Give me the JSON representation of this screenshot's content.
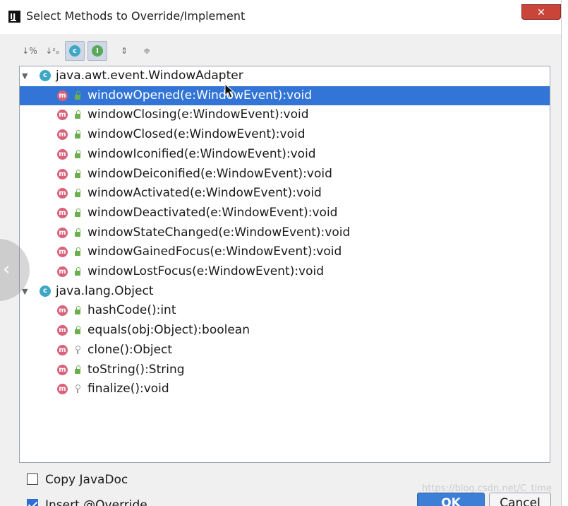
{
  "window": {
    "title": "Select Methods to Override/Implement",
    "close_label": "✕"
  },
  "toolbar": {
    "sort_visibility_glyph": "↓%",
    "sort_alpha_glyph": "↓ᶻₐ",
    "class_badge": "c",
    "interface_badge": "I",
    "expand_glyph": "⇕",
    "collapse_glyph": "≑"
  },
  "tree": {
    "groups": [
      {
        "class_name": "java.awt.event.WindowAdapter",
        "methods": [
          {
            "label": "windowOpened(e:WindowEvent):void",
            "visibility": "public",
            "selected": true
          },
          {
            "label": "windowClosing(e:WindowEvent):void",
            "visibility": "public"
          },
          {
            "label": "windowClosed(e:WindowEvent):void",
            "visibility": "public"
          },
          {
            "label": "windowIconified(e:WindowEvent):void",
            "visibility": "public"
          },
          {
            "label": "windowDeiconified(e:WindowEvent):void",
            "visibility": "public"
          },
          {
            "label": "windowActivated(e:WindowEvent):void",
            "visibility": "public"
          },
          {
            "label": "windowDeactivated(e:WindowEvent):void",
            "visibility": "public"
          },
          {
            "label": "windowStateChanged(e:WindowEvent):void",
            "visibility": "public"
          },
          {
            "label": "windowGainedFocus(e:WindowEvent):void",
            "visibility": "public"
          },
          {
            "label": "windowLostFocus(e:WindowEvent):void",
            "visibility": "public"
          }
        ]
      },
      {
        "class_name": "java.lang.Object",
        "methods": [
          {
            "label": "hashCode():int",
            "visibility": "public"
          },
          {
            "label": "equals(obj:Object):boolean",
            "visibility": "public"
          },
          {
            "label": "clone():Object",
            "visibility": "protected"
          },
          {
            "label": "toString():String",
            "visibility": "public"
          },
          {
            "label": "finalize():void",
            "visibility": "protected"
          }
        ]
      }
    ],
    "method_badge": "m",
    "class_badge": "c"
  },
  "options": {
    "copy_javadoc": {
      "label": "Copy JavaDoc",
      "checked": false
    },
    "insert_override": {
      "label": "Insert @Override",
      "checked": true
    }
  },
  "buttons": {
    "ok": "OK",
    "cancel": "Cancel"
  },
  "watermark": "https://blog.csdn.net/C_time",
  "colors": {
    "selection": "#3375d6",
    "method_icon": "#d9627a",
    "class_icon": "#3fa7c6",
    "public_lock": "#6ab04c"
  }
}
